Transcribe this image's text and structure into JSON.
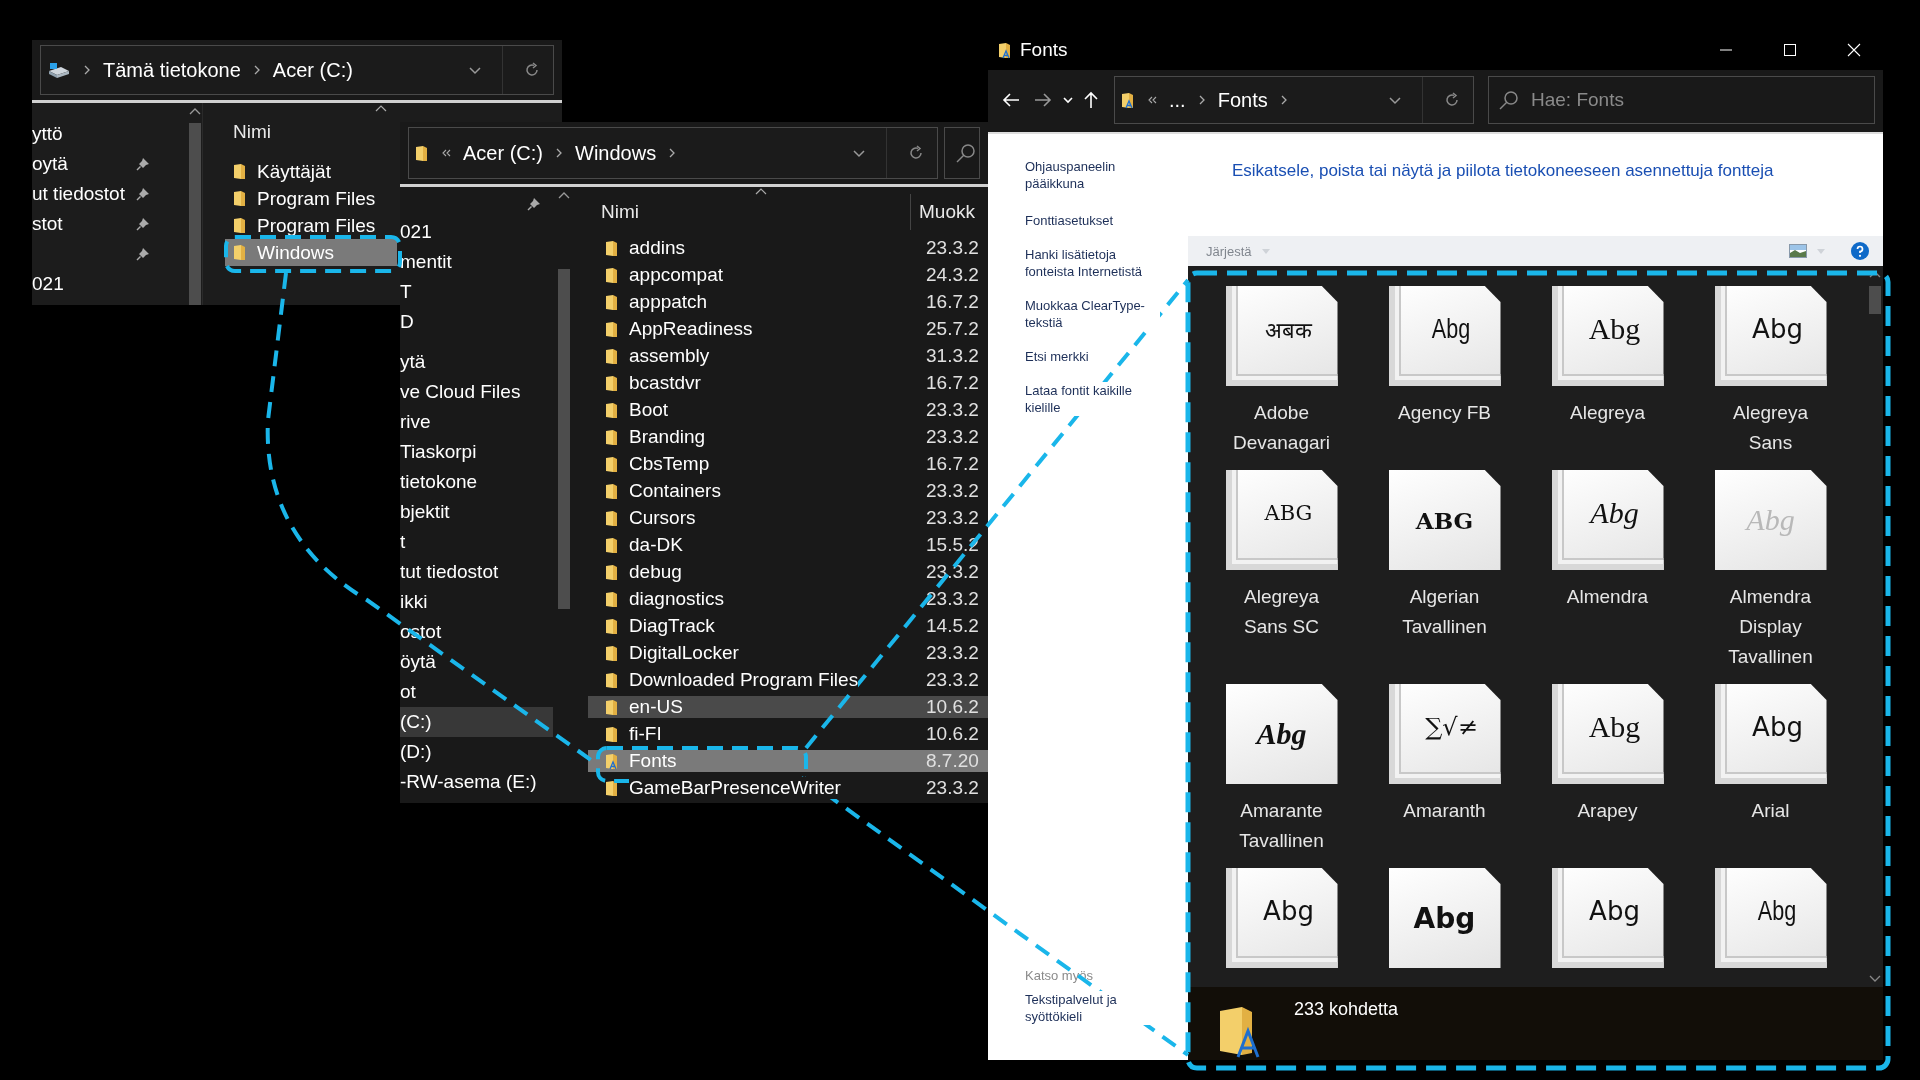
{
  "left_window": {
    "address": {
      "crumbs": [
        "Tämä tietokone",
        "Acer (C:)"
      ]
    },
    "nav_items": [
      {
        "label": "yttö",
        "pinned": false
      },
      {
        "label": "oytä",
        "pinned": true
      },
      {
        "label": "ut tiedostot",
        "pinned": true
      },
      {
        "label": "stot",
        "pinned": true
      },
      {
        "pinned": true
      },
      {
        "label": "021",
        "pinned": false
      }
    ],
    "list": {
      "column": "Nimi",
      "items": [
        {
          "name": "Käyttäjät",
          "selected": false
        },
        {
          "name": "Program Files",
          "selected": false
        },
        {
          "name": "Program Files",
          "selected": false
        },
        {
          "name": "Windows",
          "selected": true
        }
      ]
    }
  },
  "middle_window": {
    "address": {
      "crumbs": [
        "Acer (C:)",
        "Windows"
      ]
    },
    "nav_items": [
      {
        "label": "021",
        "selected": false
      },
      {
        "label": "mentit",
        "selected": false
      },
      {
        "label": "T",
        "selected": false
      },
      {
        "label": "D",
        "selected": false
      },
      {
        "label": "ytä",
        "selected": false
      },
      {
        "label": "ve Cloud Files",
        "selected": false
      },
      {
        "label": "rive",
        "selected": false
      },
      {
        "label": "Tiaskorpi",
        "selected": false
      },
      {
        "label": "tietokone",
        "selected": false
      },
      {
        "label": "bjektit",
        "selected": false
      },
      {
        "label": "t",
        "selected": false
      },
      {
        "label": "tut tiedostot",
        "selected": false
      },
      {
        "label": "ikki",
        "selected": false
      },
      {
        "label": "ostot",
        "selected": false
      },
      {
        "label": "öytä",
        "selected": false
      },
      {
        "label": "ot",
        "selected": false
      },
      {
        "label": "(C:)",
        "selected": true
      },
      {
        "label": "(D:)",
        "selected": false
      },
      {
        "label": "-RW-asema (E:)",
        "selected": false
      }
    ],
    "list": {
      "columns": [
        "Nimi",
        "Muokk"
      ],
      "rows": [
        {
          "name": "addins",
          "date": "23.3.2",
          "kind": "folder",
          "selected": false,
          "hovered": false
        },
        {
          "name": "appcompat",
          "date": "24.3.2",
          "kind": "folder",
          "selected": false,
          "hovered": false
        },
        {
          "name": "apppatch",
          "date": "16.7.2",
          "kind": "folder",
          "selected": false,
          "hovered": false
        },
        {
          "name": "AppReadiness",
          "date": "25.7.2",
          "kind": "folder",
          "selected": false,
          "hovered": false
        },
        {
          "name": "assembly",
          "date": "31.3.2",
          "kind": "folder",
          "selected": false,
          "hovered": false
        },
        {
          "name": "bcastdvr",
          "date": "16.7.2",
          "kind": "folder",
          "selected": false,
          "hovered": false
        },
        {
          "name": "Boot",
          "date": "23.3.2",
          "kind": "folder",
          "selected": false,
          "hovered": false
        },
        {
          "name": "Branding",
          "date": "23.3.2",
          "kind": "folder",
          "selected": false,
          "hovered": false
        },
        {
          "name": "CbsTemp",
          "date": "16.7.2",
          "kind": "folder",
          "selected": false,
          "hovered": false
        },
        {
          "name": "Containers",
          "date": "23.3.2",
          "kind": "folder",
          "selected": false,
          "hovered": false
        },
        {
          "name": "Cursors",
          "date": "23.3.2",
          "kind": "folder",
          "selected": false,
          "hovered": false
        },
        {
          "name": "da-DK",
          "date": "15.5.2",
          "kind": "folder",
          "selected": false,
          "hovered": false
        },
        {
          "name": "debug",
          "date": "23.3.2",
          "kind": "folder",
          "selected": false,
          "hovered": false
        },
        {
          "name": "diagnostics",
          "date": "23.3.2",
          "kind": "folder",
          "selected": false,
          "hovered": false
        },
        {
          "name": "DiagTrack",
          "date": "14.5.2",
          "kind": "folder",
          "selected": false,
          "hovered": false
        },
        {
          "name": "DigitalLocker",
          "date": "23.3.2",
          "kind": "folder",
          "selected": false,
          "hovered": false
        },
        {
          "name": "Downloaded Program Files",
          "date": "23.3.2",
          "kind": "folder",
          "selected": false,
          "hovered": false
        },
        {
          "name": "en-US",
          "date": "10.6.2",
          "kind": "folder",
          "selected": false,
          "hovered": true
        },
        {
          "name": "fi-FI",
          "date": "10.6.2",
          "kind": "folder",
          "selected": false,
          "hovered": false
        },
        {
          "name": "Fonts",
          "date": "8.7.20",
          "kind": "fonts-folder",
          "selected": true,
          "hovered": false
        },
        {
          "name": "GameBarPresenceWriter",
          "date": "23.3.2",
          "kind": "folder",
          "selected": false,
          "hovered": false
        }
      ]
    }
  },
  "fonts_window": {
    "title": "Fonts",
    "address": {
      "crumbs": [
        "...",
        "Fonts"
      ]
    },
    "search": {
      "placeholder": "Hae: Fonts"
    },
    "sidebar": {
      "links": [
        "Ohjauspaneelin pääikkuna",
        "Fonttiasetukset",
        "Hanki lisätietoja fonteista Internetistä",
        "Muokkaa ClearType-tekstiä",
        "Etsi merkki",
        "Lataa fontit kaikille kielille"
      ],
      "see_also": {
        "heading": "Katso myös",
        "links": [
          "Tekstipalvelut ja syöttökieli"
        ]
      }
    },
    "heading": "Esikatsele, poista tai näytä ja piilota tietokoneeseen asennettuja fontteja",
    "toolbar": {
      "organize": "Järjestä"
    },
    "tiles": [
      {
        "sample": "अबक",
        "kind": "devanagari",
        "stacked": true,
        "name": "Adobe Devanagari"
      },
      {
        "sample": "Abg",
        "kind": "narrow",
        "stacked": true,
        "name": "Agency FB"
      },
      {
        "sample": "Abg",
        "kind": "serif",
        "stacked": true,
        "name": "Alegreya"
      },
      {
        "sample": "Abg",
        "kind": "sans",
        "stacked": true,
        "name": "Alegreya Sans"
      },
      {
        "sample": "ABG",
        "kind": "caps",
        "stacked": true,
        "name": "Alegreya Sans SC"
      },
      {
        "sample": "ABG",
        "kind": "bold-serif",
        "stacked": false,
        "name": "Algerian Tavallinen"
      },
      {
        "sample": "Abg",
        "kind": "script",
        "stacked": true,
        "name": "Almendra"
      },
      {
        "sample": "Abg",
        "kind": "faint",
        "stacked": false,
        "name": "Almendra Display Tavallinen"
      },
      {
        "sample": "Abg",
        "kind": "bold-script",
        "stacked": false,
        "name": "Amarante Tavallinen"
      },
      {
        "sample": "∑√≠",
        "kind": "symbol",
        "stacked": true,
        "name": "Amaranth"
      },
      {
        "sample": "Abg",
        "kind": "serif",
        "stacked": true,
        "name": "Arapey"
      },
      {
        "sample": "Abg",
        "kind": "sans",
        "stacked": true,
        "name": "Arial"
      },
      {
        "sample": "Abg",
        "kind": "sans",
        "stacked": true
      },
      {
        "sample": "Abg",
        "kind": "bold-sans",
        "stacked": false
      },
      {
        "sample": "Abg",
        "kind": "sans",
        "stacked": true
      },
      {
        "sample": "Abg",
        "kind": "narrow",
        "stacked": true
      }
    ],
    "status": "233 kohdetta"
  }
}
